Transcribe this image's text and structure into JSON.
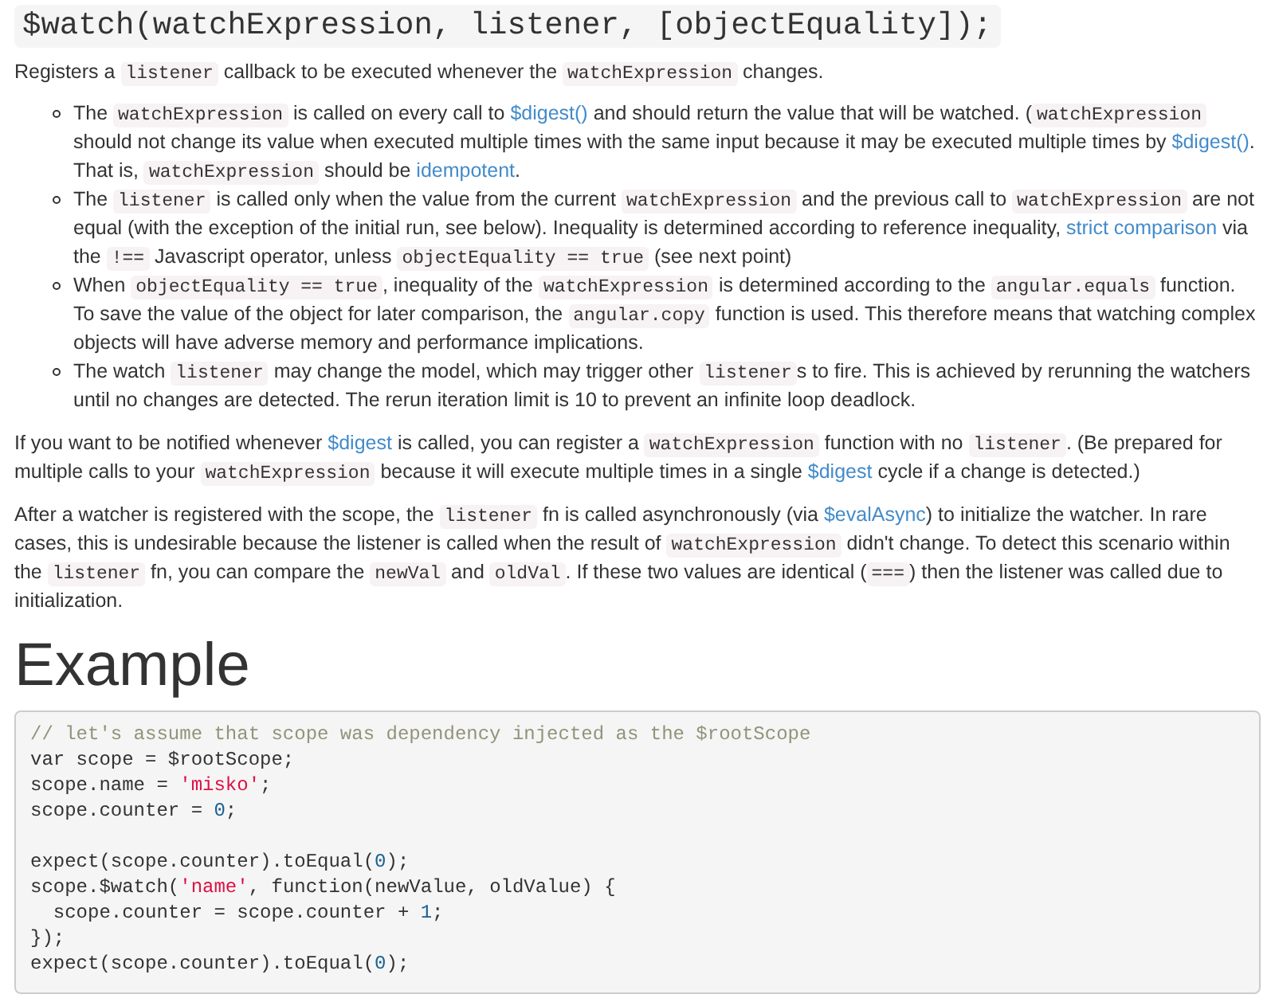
{
  "signature": "$watch(watchExpression, listener, [objectEquality]);",
  "intro": [
    {
      "kind": "text",
      "text": "Registers a "
    },
    {
      "kind": "code",
      "text": "listener"
    },
    {
      "kind": "text",
      "text": " callback to be executed whenever the "
    },
    {
      "kind": "code",
      "text": "watchExpression"
    },
    {
      "kind": "text",
      "text": " changes."
    }
  ],
  "bullets": [
    [
      {
        "kind": "text",
        "text": "The "
      },
      {
        "kind": "code",
        "text": "watchExpression"
      },
      {
        "kind": "text",
        "text": " is called on every call to "
      },
      {
        "kind": "link",
        "text": "$digest()"
      },
      {
        "kind": "text",
        "text": " and should return the value that will be watched. ("
      },
      {
        "kind": "code",
        "text": "watchExpression"
      },
      {
        "kind": "text",
        "text": " should not change its value when executed multiple times with the same input because it may be executed multiple times by "
      },
      {
        "kind": "link",
        "text": "$digest()"
      },
      {
        "kind": "text",
        "text": ". That is, "
      },
      {
        "kind": "code",
        "text": "watchExpression"
      },
      {
        "kind": "text",
        "text": " should be "
      },
      {
        "kind": "link",
        "text": "idempotent"
      },
      {
        "kind": "text",
        "text": "."
      }
    ],
    [
      {
        "kind": "text",
        "text": "The "
      },
      {
        "kind": "code",
        "text": "listener"
      },
      {
        "kind": "text",
        "text": " is called only when the value from the current "
      },
      {
        "kind": "code",
        "text": "watchExpression"
      },
      {
        "kind": "text",
        "text": " and the previous call to "
      },
      {
        "kind": "code",
        "text": "watchExpression"
      },
      {
        "kind": "text",
        "text": " are not equal (with the exception of the initial run, see below). Inequality is determined according to reference inequality, "
      },
      {
        "kind": "link",
        "text": "strict comparison"
      },
      {
        "kind": "text",
        "text": " via the "
      },
      {
        "kind": "code",
        "text": "!=="
      },
      {
        "kind": "text",
        "text": " Javascript operator, unless "
      },
      {
        "kind": "code",
        "text": "objectEquality == true"
      },
      {
        "kind": "text",
        "text": " (see next point)"
      }
    ],
    [
      {
        "kind": "text",
        "text": "When "
      },
      {
        "kind": "code",
        "text": "objectEquality == true"
      },
      {
        "kind": "text",
        "text": ", inequality of the "
      },
      {
        "kind": "code",
        "text": "watchExpression"
      },
      {
        "kind": "text",
        "text": " is determined according to the "
      },
      {
        "kind": "code",
        "text": "angular.equals"
      },
      {
        "kind": "text",
        "text": " function. To save the value of the object for later comparison, the "
      },
      {
        "kind": "code",
        "text": "angular.copy"
      },
      {
        "kind": "text",
        "text": " function is used. This therefore means that watching complex objects will have adverse memory and performance implications."
      }
    ],
    [
      {
        "kind": "text",
        "text": "The watch "
      },
      {
        "kind": "code",
        "text": "listener"
      },
      {
        "kind": "text",
        "text": " may change the model, which may trigger other "
      },
      {
        "kind": "code",
        "text": "listener"
      },
      {
        "kind": "text",
        "text": "s to fire. This is achieved by rerunning the watchers until no changes are detected. The rerun iteration limit is 10 to prevent an infinite loop deadlock."
      }
    ]
  ],
  "paragraphs": [
    [
      {
        "kind": "text",
        "text": "If you want to be notified whenever "
      },
      {
        "kind": "link",
        "text": "$digest"
      },
      {
        "kind": "text",
        "text": " is called, you can register a "
      },
      {
        "kind": "code",
        "text": "watchExpression"
      },
      {
        "kind": "text",
        "text": " function with no "
      },
      {
        "kind": "code",
        "text": "listener"
      },
      {
        "kind": "text",
        "text": ". (Be prepared for multiple calls to your "
      },
      {
        "kind": "code",
        "text": "watchExpression"
      },
      {
        "kind": "text",
        "text": " because it will execute multiple times in a single "
      },
      {
        "kind": "link",
        "text": "$digest"
      },
      {
        "kind": "text",
        "text": " cycle if a change is detected.)"
      }
    ],
    [
      {
        "kind": "text",
        "text": "After a watcher is registered with the scope, the "
      },
      {
        "kind": "code",
        "text": "listener"
      },
      {
        "kind": "text",
        "text": " fn is called asynchronously (via "
      },
      {
        "kind": "link",
        "text": "$evalAsync"
      },
      {
        "kind": "text",
        "text": ") to initialize the watcher. In rare cases, this is undesirable because the listener is called when the result of "
      },
      {
        "kind": "code",
        "text": "watchExpression"
      },
      {
        "kind": "text",
        "text": " didn't change. To detect this scenario within the "
      },
      {
        "kind": "code",
        "text": "listener"
      },
      {
        "kind": "text",
        "text": " fn, you can compare the "
      },
      {
        "kind": "code",
        "text": "newVal"
      },
      {
        "kind": "text",
        "text": " and "
      },
      {
        "kind": "code",
        "text": "oldVal"
      },
      {
        "kind": "text",
        "text": ". If these two values are identical ("
      },
      {
        "kind": "code",
        "text": "==="
      },
      {
        "kind": "text",
        "text": ") then the listener was called due to initialization."
      }
    ]
  ],
  "example_heading": "Example",
  "code_lines": [
    {
      "kind": "code",
      "tokens": [
        {
          "kind": "comment",
          "text": "// let's assume that scope was dependency injected as the $rootScope"
        }
      ]
    },
    {
      "kind": "code",
      "tokens": [
        {
          "kind": "plain",
          "text": "var scope = $rootScope;"
        }
      ]
    },
    {
      "kind": "code",
      "tokens": [
        {
          "kind": "plain",
          "text": "scope.name = "
        },
        {
          "kind": "string",
          "text": "'misko'"
        },
        {
          "kind": "plain",
          "text": ";"
        }
      ]
    },
    {
      "kind": "code",
      "tokens": [
        {
          "kind": "plain",
          "text": "scope.counter = "
        },
        {
          "kind": "number",
          "text": "0"
        },
        {
          "kind": "plain",
          "text": ";"
        }
      ]
    },
    {
      "kind": "blank"
    },
    {
      "kind": "code",
      "tokens": [
        {
          "kind": "plain",
          "text": "expect(scope.counter).toEqual("
        },
        {
          "kind": "number",
          "text": "0"
        },
        {
          "kind": "plain",
          "text": ");"
        }
      ]
    },
    {
      "kind": "code",
      "tokens": [
        {
          "kind": "plain",
          "text": "scope.$watch("
        },
        {
          "kind": "string",
          "text": "'name'"
        },
        {
          "kind": "plain",
          "text": ", function(newValue, oldValue) {"
        }
      ]
    },
    {
      "kind": "code",
      "tokens": [
        {
          "kind": "plain",
          "text": "  scope.counter = scope.counter + "
        },
        {
          "kind": "number",
          "text": "1"
        },
        {
          "kind": "plain",
          "text": ";"
        }
      ]
    },
    {
      "kind": "code",
      "tokens": [
        {
          "kind": "plain",
          "text": "});"
        }
      ]
    },
    {
      "kind": "code",
      "tokens": [
        {
          "kind": "plain",
          "text": "expect(scope.counter).toEqual("
        },
        {
          "kind": "number",
          "text": "0"
        },
        {
          "kind": "plain",
          "text": ");"
        }
      ]
    }
  ]
}
